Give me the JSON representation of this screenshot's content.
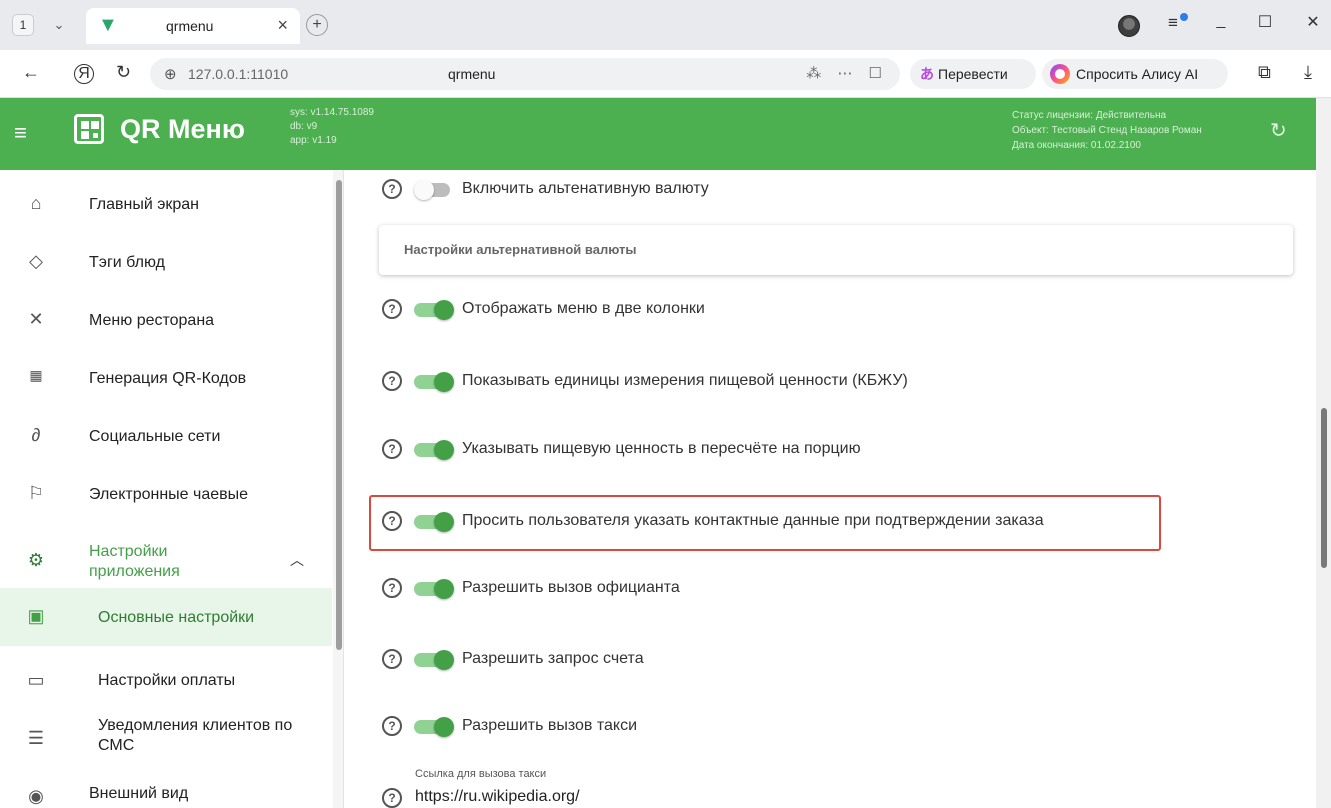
{
  "browser": {
    "tab_count": "1",
    "tab_dropdown": "⌄",
    "tab_title": "qrmenu",
    "tab_close": "×",
    "new_tab": "+",
    "address": "127.0.0.1:11010",
    "page_title": "qrmenu",
    "url_actions": "⁂ ⋯ ☐",
    "translate_label": "Перевести",
    "alice_label": "Спросить Алису AI",
    "minimize": "_",
    "maximize": "☐",
    "close": "✕"
  },
  "header": {
    "title": "QR Меню",
    "sys_version": "sys: v1.14.75.1089",
    "db_version": "db: v9",
    "app_version": "app: v1.19",
    "license_status": "Статус лицензии: Действительна",
    "license_object": "Объект: Тестовый Стенд Назаров Роман",
    "license_end": "Дата окончания: 01.02.2100"
  },
  "sidebar": {
    "items": [
      {
        "label": "Главный экран",
        "icon": "home-icon"
      },
      {
        "label": "Тэги блюд",
        "icon": "tag-icon"
      },
      {
        "label": "Меню ресторана",
        "icon": "utensils-icon"
      },
      {
        "label": "Генерация QR-Кодов",
        "icon": "qr-code-icon"
      },
      {
        "label": "Социальные сети",
        "icon": "link-icon"
      },
      {
        "label": "Электронные чаевые",
        "icon": "tips-icon"
      },
      {
        "label": "Настройки приложения",
        "icon": "app-settings-icon"
      }
    ],
    "sub_items": [
      {
        "label": "Основные настройки",
        "icon": "settings-card-icon"
      },
      {
        "label": "Настройки оплаты",
        "icon": "card-icon"
      },
      {
        "label": "Уведомления клиентов по СМС",
        "icon": "sms-icon"
      }
    ],
    "bottom_item": {
      "label": "Внешний вид",
      "icon": "eye-icon"
    }
  },
  "settings": {
    "alt_currency": {
      "label": "Включить альтенативную валюту",
      "enabled": false
    },
    "alt_card_title": "Настройки альтернативной валюты",
    "toggles": [
      {
        "label": "Отображать меню в две колонки",
        "enabled": true
      },
      {
        "label": "Показывать единицы измерения пищевой ценности (КБЖУ)",
        "enabled": true
      },
      {
        "label": "Указывать пищевую ценность в пересчёте на порцию",
        "enabled": true
      },
      {
        "label": "Просить пользователя указать контактные данные при подтверждении заказа",
        "enabled": true
      },
      {
        "label": "Разрешить вызов официанта",
        "enabled": true
      },
      {
        "label": "Разрешить запрос счета",
        "enabled": true
      },
      {
        "label": "Разрешить вызов такси",
        "enabled": true
      }
    ],
    "taxi_link_caption": "Ссылка для вызова такси",
    "taxi_link_value": "https://ru.wikipedia.org/"
  },
  "colors": {
    "brand": "#4caf50",
    "highlight": "#d94a3d",
    "active_bg": "#e8f5e9"
  }
}
